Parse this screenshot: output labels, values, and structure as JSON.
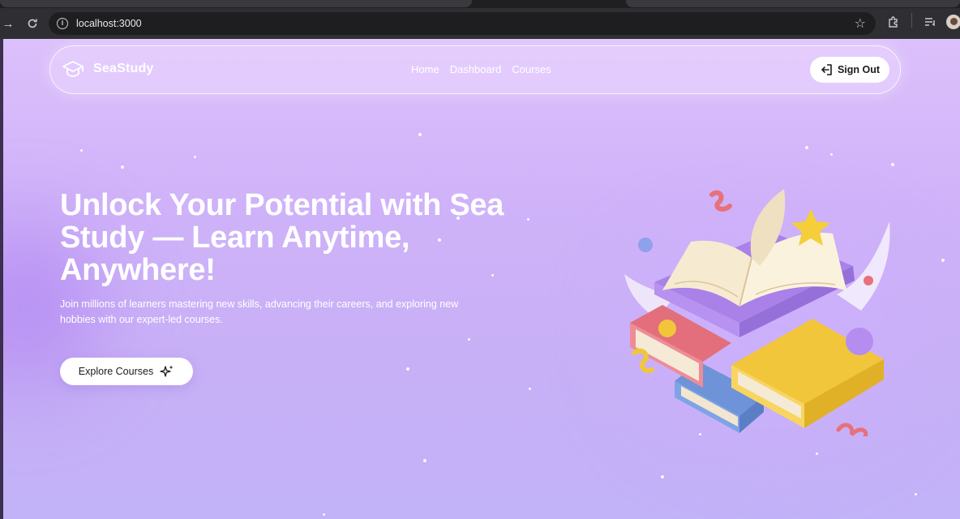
{
  "browser": {
    "url": "localhost:3000"
  },
  "navbar": {
    "brand": "SeaStudy",
    "links": [
      "Home",
      "Dashboard",
      "Courses"
    ],
    "sign_out_label": "Sign Out"
  },
  "hero": {
    "title": "Unlock Your Potential with Sea Study — Learn Anytime, Anywhere!",
    "subtitle": "Join millions of learners mastering new skills, advancing their careers, and exploring new hobbies with our expert-led courses.",
    "cta_label": "Explore Courses"
  },
  "icons": {
    "brand": "graduation-cap-icon",
    "sign_out": "logout-icon",
    "cta": "sparkles-icon"
  },
  "colors": {
    "page_top": "#dcc0fb",
    "page_bottom": "#c2b2f8",
    "button_bg": "#ffffff",
    "text_dark": "#1b1b1b"
  }
}
